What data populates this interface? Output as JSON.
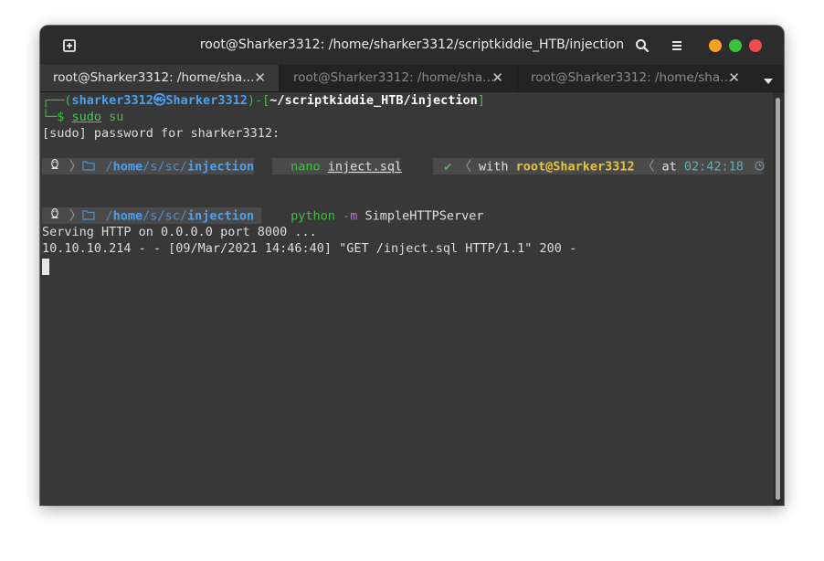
{
  "window": {
    "title": "root@Sharker3312: /home/sharker3312/scriptkiddie_HTB/injection"
  },
  "tabs": [
    {
      "label": "root@Sharker3312: /home/sha…",
      "active": true
    },
    {
      "label": "root@Sharker3312: /home/sha…",
      "active": false
    },
    {
      "label": "root@Sharker3312: /home/sha…",
      "active": false
    }
  ],
  "tab_close_glyph": "✕",
  "icons": {
    "new_tab": "new-tab-icon",
    "search": "search-icon",
    "menu": "hamburger-menu-icon",
    "linux": "tux-icon",
    "folder": "folder-icon",
    "check": "checkmark-icon",
    "clock": "clock-icon"
  },
  "colors": {
    "minimize": "#f4a125",
    "maximize": "#3ec13e",
    "close": "#ee4b4b",
    "terminal_bg": "#383838"
  },
  "terminal": {
    "prompt": {
      "open": "┌──(",
      "user": "sharker3312",
      "at": "㉿",
      "host": "Sharker3312",
      "mid": ")-[",
      "path": "~/scriptkiddie_HTB/injection",
      "close": "]",
      "line2_prefix": "└─$ ",
      "cmd": "sudo",
      "args": " su"
    },
    "sudo_prompt": "[sudo] password for sharker3312:",
    "pl1": {
      "path_sep1": "/",
      "path_home": "home",
      "path_sep2": "/",
      "path_s": "s",
      "path_sep3": "/",
      "path_sc": "sc",
      "path_sep4": "/",
      "path_dir": "injection",
      "cmd": "nano",
      "arg": "inject.sql",
      "check": "✔",
      "with": "with",
      "user": "root@Sharker3312",
      "at": "at",
      "time": "02:42:18"
    },
    "pl2": {
      "path_sep1": "/",
      "path_home": "home",
      "path_sep2": "/",
      "path_s": "s",
      "path_sep3": "/",
      "path_sc": "sc",
      "path_sep4": "/",
      "path_dir": "injection",
      "cmd": "python",
      "flag": "-m",
      "arg": "SimpleHTTPServer"
    },
    "output": [
      "Serving HTTP on 0.0.0.0 port 8000 ...",
      "10.10.10.214 - - [09/Mar/2021 14:46:40] \"GET /inject.sql HTTP/1.1\" 200 -"
    ]
  }
}
